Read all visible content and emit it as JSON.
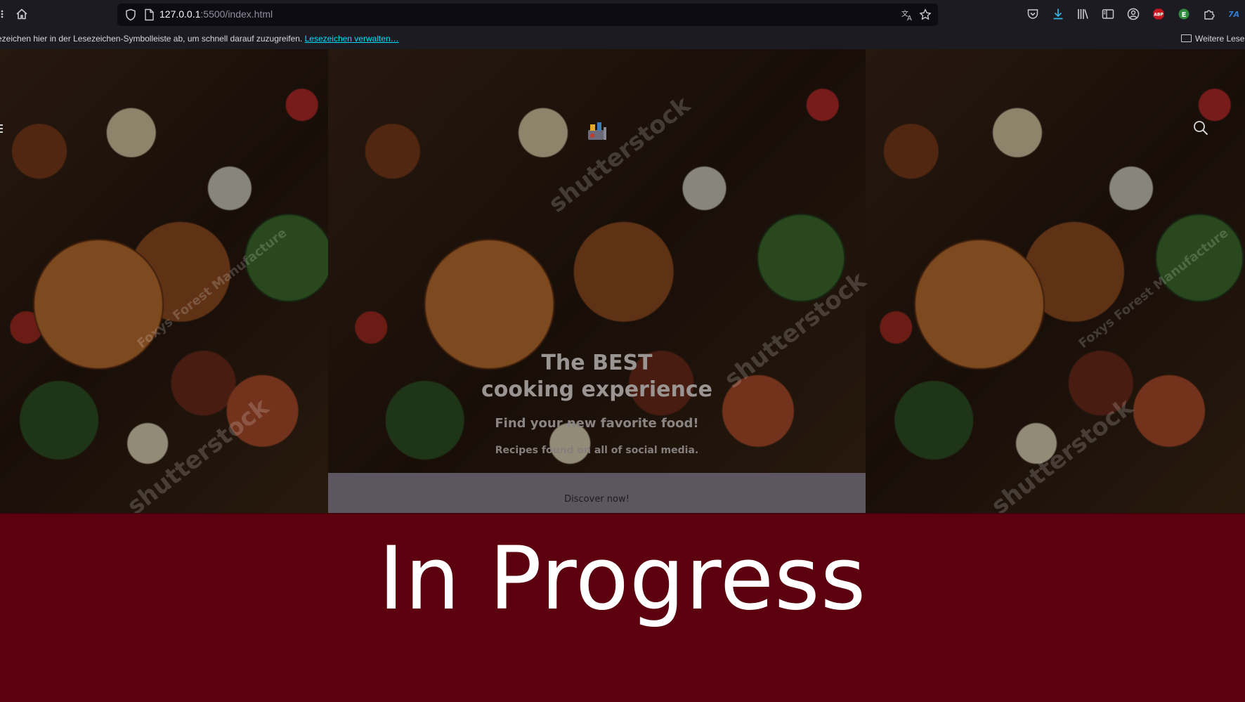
{
  "browser": {
    "url_host": "127.0.0.1",
    "url_path": ":5500/index.html",
    "toolbar_icons": [
      "home-icon",
      "shield-icon",
      "page-icon",
      "translate-icon",
      "star-icon",
      "pocket-icon",
      "download-icon",
      "library-icon",
      "sidebar-icon",
      "account-icon",
      "adblock-icon",
      "extension-e-icon",
      "extensions-icon",
      "extension-blue-icon"
    ],
    "adblock_label": "ABP",
    "extension_e_label": "E",
    "extension_blue_label": "7A"
  },
  "bookmarks_bar": {
    "message": "ezeichen hier in der Lesezeichen-Symbolleiste ab, um schnell darauf zuzugreifen.",
    "manage_link": "Lesezeichen verwalten…",
    "folder_label": "Weitere Lesez"
  },
  "hero": {
    "title_line1": "The BEST",
    "title_line2": "cooking experience",
    "subtitle": "Find your new favorite food!",
    "tagline": "Recipes found on all of social media.",
    "cta_label": "Discover now!",
    "watermark_brand": "shutterstock",
    "watermark_artist": "Foxys Forest Manufacture"
  },
  "overlay": {
    "status_text": "In Progress",
    "background_color": "#5c000f"
  }
}
